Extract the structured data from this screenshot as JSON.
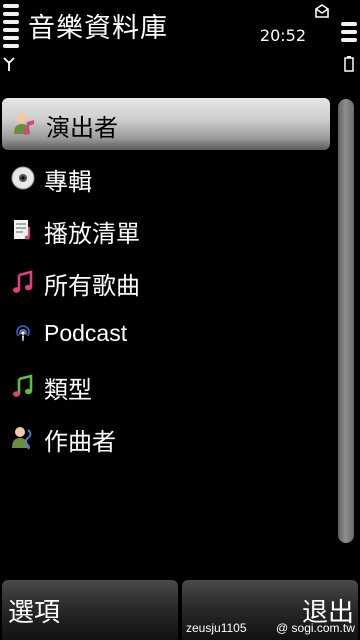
{
  "status": {
    "title": "音樂資料庫",
    "time": "20:52",
    "signal_icon": "antenna-icon",
    "battery_icon": "battery-icon",
    "notification_icon": "mail-icon"
  },
  "menu": {
    "items": [
      {
        "label": "演出者",
        "icon": "artist-icon",
        "selected": true
      },
      {
        "label": "專輯",
        "icon": "album-disc-icon",
        "selected": false
      },
      {
        "label": "播放清單",
        "icon": "playlist-icon",
        "selected": false
      },
      {
        "label": "所有歌曲",
        "icon": "music-note-icon",
        "selected": false
      },
      {
        "label": "Podcast",
        "icon": "podcast-icon",
        "selected": false
      },
      {
        "label": "類型",
        "icon": "genre-icon",
        "selected": false
      },
      {
        "label": "作曲者",
        "icon": "composer-icon",
        "selected": false
      }
    ]
  },
  "softkeys": {
    "left_label": "選項",
    "right_label": "退出"
  },
  "watermark": {
    "user": "zeusju1105",
    "site": "@ sogi.com.tw"
  },
  "colors": {
    "background": "#000000",
    "highlight": "#cfcfcf",
    "music_pink": "#e0407f",
    "music_green": "#5fbf3a"
  }
}
